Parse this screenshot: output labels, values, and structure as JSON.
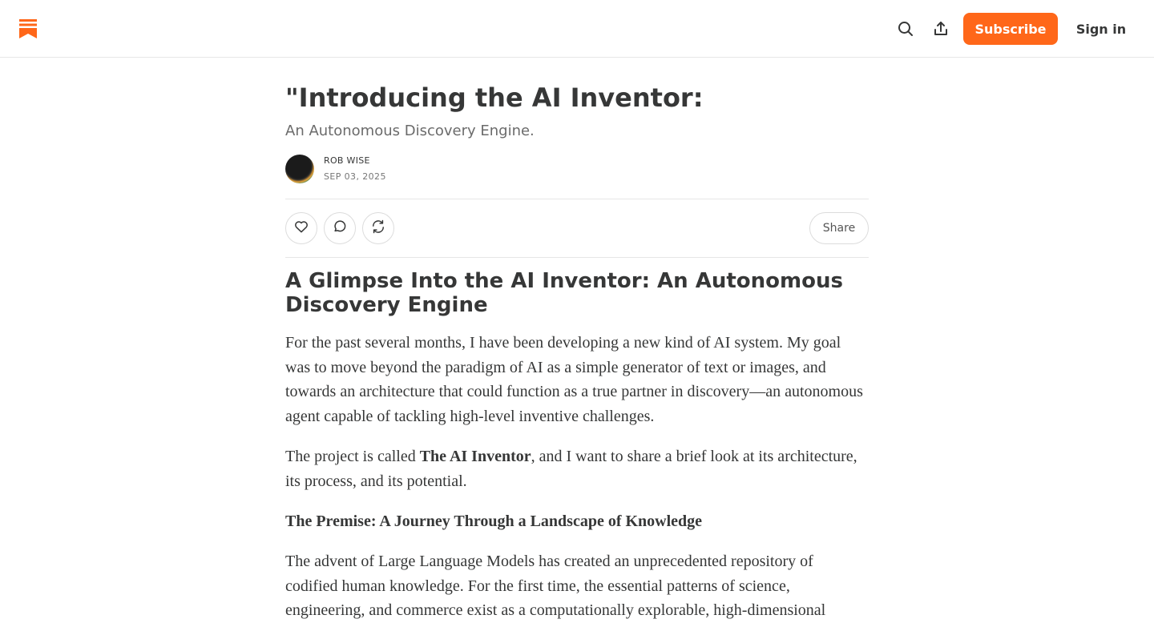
{
  "header": {
    "logo": "substack-bookmark-logo",
    "search_icon": "search-icon",
    "share_icon": "upload-share-icon",
    "subscribe_label": "Subscribe",
    "signin_label": "Sign in",
    "accent_color": "#ff6719"
  },
  "post": {
    "title": "\"Introducing the AI Inventor:",
    "subtitle": "An Autonomous Discovery Engine.",
    "author": "ROB WISE",
    "date": "SEP 03, 2025",
    "actions": {
      "like_icon": "heart-icon",
      "comment_icon": "comment-icon",
      "restack_icon": "restack-icon",
      "share_label": "Share"
    },
    "heading": "A Glimpse Into the AI Inventor: An Autonomous Discovery Engine",
    "p1": "For the past several months, I have been developing a new kind of AI system. My goal was to move beyond the paradigm of AI as a simple generator of text or images, and towards an architecture that could function as a true partner in discovery—an autonomous agent capable of tackling high-level inventive challenges.",
    "p2_pre": "The project is called ",
    "p2_bold": "The AI Inventor",
    "p2_post": ", and I want to share a brief look at its architecture, its process, and its potential.",
    "section_heading": "The Premise: A Journey Through a Landscape of Knowledge",
    "p3": "The advent of Large Language Models has created an unprecedented repository of codified human knowledge. For the first time, the essential patterns of science, engineering, and commerce exist as a computationally explorable, high-dimensional"
  }
}
